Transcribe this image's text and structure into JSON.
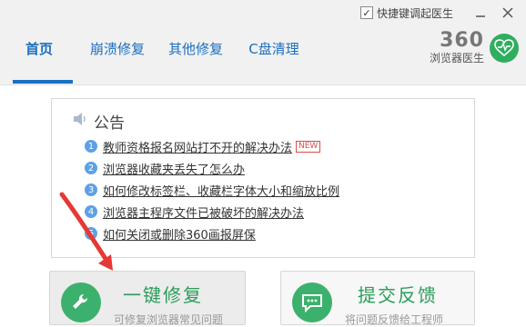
{
  "window": {
    "checkbox_label": "快捷键调起医生",
    "checkbox_checked": true
  },
  "tabs": [
    {
      "label": "首页",
      "active": true
    },
    {
      "label": "崩溃修复",
      "active": false
    },
    {
      "label": "其他修复",
      "active": false
    },
    {
      "label": "C盘清理",
      "active": false
    }
  ],
  "brand": {
    "number": "360",
    "subtitle": "浏览器医生"
  },
  "notice": {
    "title": "公告",
    "items": [
      {
        "index": "1",
        "text": "教师资格报名网站打不开的解决办法",
        "badge": "NEW"
      },
      {
        "index": "2",
        "text": "浏览器收藏夹丢失了怎么办"
      },
      {
        "index": "3",
        "text": "如何修改标签栏、收藏栏字体大小和缩放比例"
      },
      {
        "index": "4",
        "text": "浏览器主程序文件已被破坏的解决办法"
      },
      {
        "index": "5",
        "text": "如何关闭或删除360画报屏保"
      }
    ]
  },
  "actions": {
    "repair": {
      "label": "一键修复",
      "hint": "可修复浏览器常见问题"
    },
    "feedback": {
      "label": "提交反馈",
      "hint": "将问题反馈给工程师"
    }
  },
  "colors": {
    "accent": "#1a6fc1",
    "green": "#3cb16d",
    "arrow": "#e53935"
  }
}
